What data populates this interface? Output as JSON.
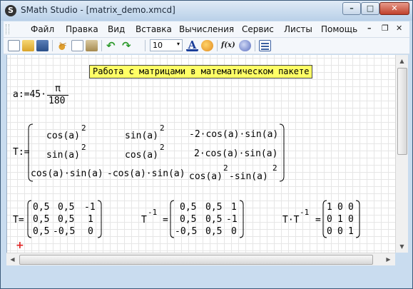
{
  "window": {
    "title": "SMath Studio - [matrix_demo.xmcd]",
    "app_icon_glyph": "S",
    "minimize_glyph": "–",
    "maximize_glyph": "□",
    "close_glyph": "✕"
  },
  "menu": {
    "items": [
      "Файл",
      "Правка",
      "Вид",
      "Вставка",
      "Вычисления",
      "Сервис",
      "Листы",
      "Помощь"
    ],
    "mdi_minimize": "–",
    "mdi_restore": "❐",
    "mdi_close": "✕"
  },
  "toolbar": {
    "font_size": "10",
    "font_size_arrow": "▾",
    "letter_a": "A",
    "fx_label": "f(x)",
    "icons": [
      "new-document-icon",
      "open-folder-icon",
      "save-icon",
      "cut-icon",
      "copy-icon",
      "paste-icon",
      "undo-icon",
      "redo-icon",
      "text-color-icon",
      "highlight-icon",
      "function-icon",
      "insert-unit-icon",
      "worksheet-icon"
    ]
  },
  "worksheet": {
    "heading": "Работа с матрицами в математическом пакете",
    "a_def": {
      "lhs": "a:=45·",
      "numerator": "π",
      "denominator": "180"
    },
    "T_def": {
      "lhs": "T:=",
      "rows": [
        [
          "cos(a)",
          "sin(a)",
          "-2·cos(a)·sin(a)"
        ],
        [
          "sin(a)",
          "cos(a)",
          "2·cos(a)·sin(a)"
        ],
        [
          "cos(a)·sin(a)",
          "-cos(a)·sin(a)",
          "cos(a)"
        ]
      ],
      "cell_suffix": [
        "",
        "",
        "",
        "",
        "",
        "",
        "",
        "",
        "-sin(a)"
      ],
      "exponent": "2"
    },
    "T_result": {
      "lhs": "T=",
      "rows": [
        [
          "0,5",
          "0,5",
          "-1"
        ],
        [
          "0,5",
          "0,5",
          "1"
        ],
        [
          "0,5",
          "-0,5",
          "0"
        ]
      ]
    },
    "Tinv_result": {
      "lhs_base": "T",
      "lhs_exp": "-1",
      "eq": "=",
      "rows": [
        [
          "0,5",
          "0,5",
          "1"
        ],
        [
          "0,5",
          "0,5",
          "-1"
        ],
        [
          "-0,5",
          "0,5",
          "0"
        ]
      ]
    },
    "product_result": {
      "lhs_base": "T·T",
      "lhs_exp": "-1",
      "eq": "=",
      "rows": [
        [
          "1",
          "0",
          "0"
        ],
        [
          "0",
          "1",
          "0"
        ],
        [
          "0",
          "0",
          "1"
        ]
      ]
    },
    "cursor": "+"
  },
  "colors": {
    "heading_bg": "#ffff66",
    "cursor": "#e02020",
    "grid": "#e6e6e6"
  }
}
